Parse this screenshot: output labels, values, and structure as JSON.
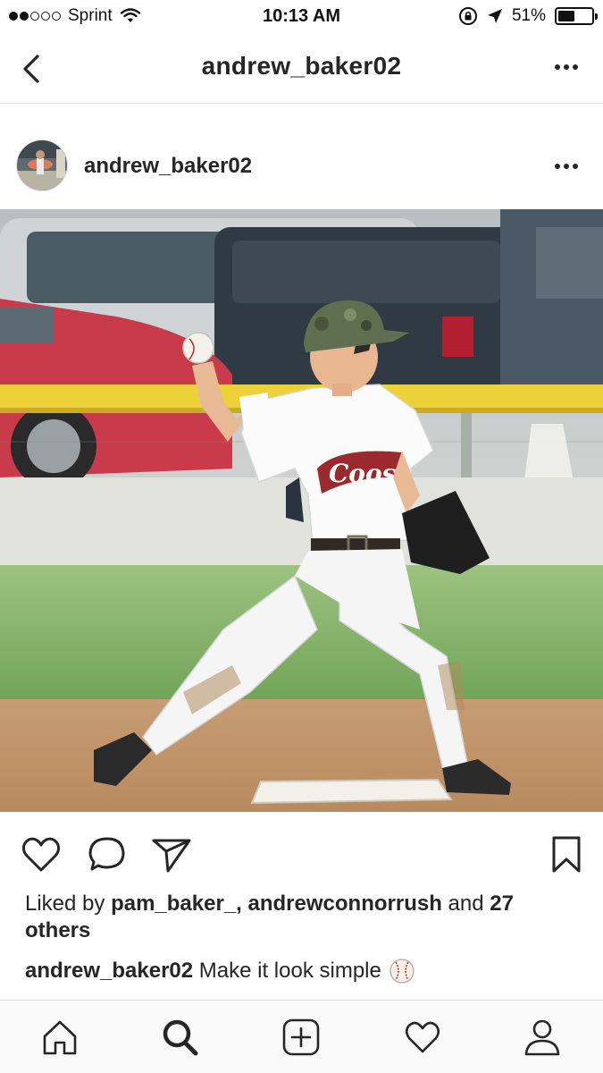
{
  "status_bar": {
    "carrier": "Sprint",
    "time": "10:13 AM",
    "battery": "51%",
    "battery_level": 0.51,
    "signal_bars_filled": 2,
    "signal_bars_total": 5
  },
  "header": {
    "title": "andrew_baker02",
    "back_icon": "chevron-left-icon",
    "more_icon": "more-horizontal-icon"
  },
  "post": {
    "username": "andrew_baker02",
    "more_icon": "more-horizontal-icon",
    "likes": {
      "prefix": "Liked by ",
      "user1": "pam_baker_,",
      "user2": "andrewconnorrush",
      "middle": " and ",
      "others": "27 others"
    },
    "caption": {
      "username": "andrew_baker02",
      "text": "Make it look simple"
    },
    "jersey_text": "Coosa"
  },
  "actions": {
    "like_icon": "heart-icon",
    "comment_icon": "comment-icon",
    "share_icon": "send-icon",
    "save_icon": "bookmark-icon"
  },
  "tabs": [
    {
      "icon": "home-icon"
    },
    {
      "icon": "search-icon",
      "active": true
    },
    {
      "icon": "add-post-icon"
    },
    {
      "icon": "activity-heart-icon"
    },
    {
      "icon": "profile-icon"
    }
  ],
  "colors": {
    "text": "#262626",
    "divider": "#dbdbdb",
    "jersey_red": "#9b2a2f"
  }
}
